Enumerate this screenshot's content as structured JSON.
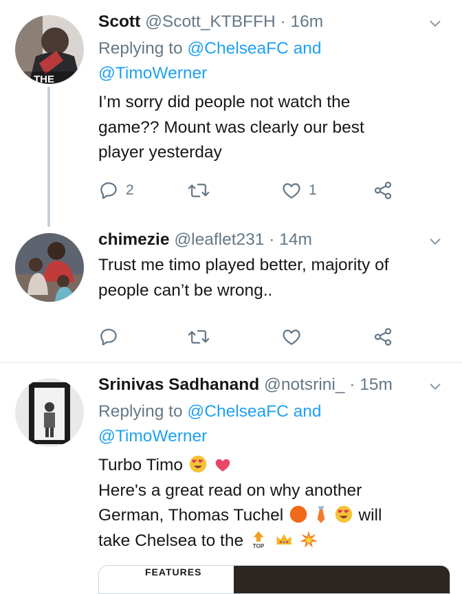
{
  "tweets": [
    {
      "name": "Scott",
      "handle": "@Scott_KTBFFH",
      "separator": "·",
      "time": "16m",
      "replying_prefix": "Replying to",
      "replying_mentions": "@ChelseaFC and",
      "replying_mentions_2": "@TimoWerner",
      "body_lines": [
        "I’m sorry did people not watch the",
        "game?? Mount was clearly our best",
        "player yesterday"
      ],
      "reply_count": "2",
      "like_count": "1",
      "avatar_text": "THE"
    },
    {
      "name": "chimezie",
      "handle": "@leaflet231",
      "separator": "·",
      "time": "14m",
      "body_lines": [
        "Trust me timo played better, majority of",
        "people can’t be wrong.."
      ]
    },
    {
      "name": "Srinivas Sadhanand",
      "handle": "@notsrini_",
      "separator": "·",
      "time": "15m",
      "replying_prefix": "Replying to",
      "replying_mentions": "@ChelseaFC and",
      "replying_mentions_2": "@TimoWerner",
      "body_line_1": "Turbo Timo",
      "body_line_2": "Here's a great read on why another",
      "body_line_3a": "German, Thomas Tuchel",
      "body_line_3b": "will",
      "body_line_4": "take Chelsea to the",
      "top_emoji_text": "TOP",
      "card_label": "FEATURES"
    }
  ],
  "colors": {
    "text": "#14171a",
    "secondary": "#657786",
    "link": "#1da1f2",
    "divider": "#e1e8ed",
    "thread_line": "#c4cfd6"
  },
  "icons": [
    "reply-icon",
    "retweet-icon",
    "like-icon",
    "share-icon",
    "caret-down-icon"
  ]
}
